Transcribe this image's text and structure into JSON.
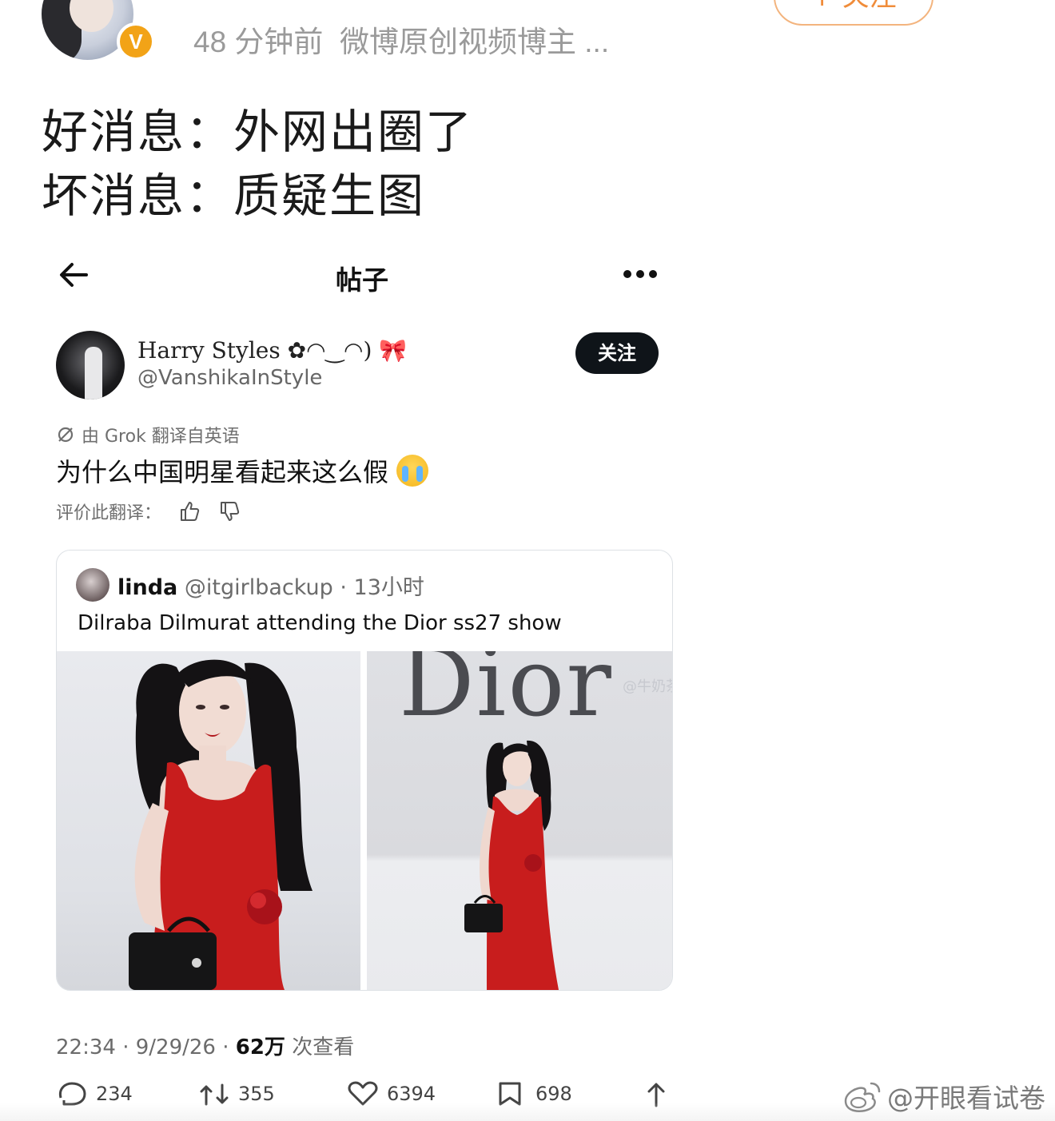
{
  "weibo_header": {
    "time_ago": "48 分钟前",
    "account_type": "微博原创视频博主 ...",
    "vip_badge": "V",
    "follow_button": "+ 关注"
  },
  "post": {
    "line1": "好消息：外网出圈了",
    "line2": "坏消息：质疑生图"
  },
  "embedded_post": {
    "nav_title": "帖子",
    "author_name": "Harry Styles ✿◠‿◠) 🎀",
    "author_handle": "@VanshikaInStyle",
    "follow_label": "关注",
    "grok_note": "由 Grok 翻译自英语",
    "text": "为什么中国明星看起来这么假",
    "rate_label": "评价此翻译：",
    "quote": {
      "name": "linda",
      "meta": "@itgirlbackup · 13小时",
      "text": "Dilraba Dilmurat attending the Dior ss27 show",
      "image_text": "Dior",
      "image_watermark": "@牛奶茶"
    },
    "timestamp": "22:34 · 9/29/26 · ",
    "views_count": "62万",
    "views_label": " 次查看",
    "actions": {
      "reply": "234",
      "repost": "355",
      "like": "6394",
      "bookmark": "698"
    }
  },
  "watermark": "@开眼看试卷",
  "colors": {
    "accent_orange": "#f08c3a",
    "vip_gold": "#f2a317",
    "dress_red": "#c81d1d",
    "follow_dark": "#0f1419"
  }
}
